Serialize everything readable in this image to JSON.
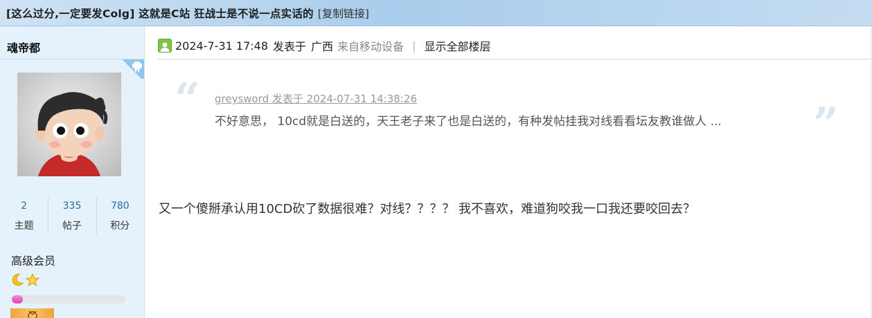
{
  "header": {
    "thread_title": "[这么过分,一定要发Colg] 这就是C站 狂战士是不说一点实话的",
    "copy_link_label": "[复制链接]"
  },
  "user": {
    "name": "魂帝都",
    "stats": [
      {
        "value": "2",
        "label": "主题"
      },
      {
        "value": "335",
        "label": "帖子"
      },
      {
        "value": "780",
        "label": "积分"
      }
    ],
    "rank": "高级会员",
    "rank_icons": [
      "moon-icon",
      "star-icon"
    ],
    "level_progress": 0.1
  },
  "post": {
    "timestamp": "2024-7-31 17:48",
    "posted_at": "发表于",
    "location": "广西",
    "device": "来自移动设备",
    "pipe": "|",
    "show_all_floors": "显示全部楼层",
    "quote": {
      "author_line": "greysword 发表于 2024-07-31 14:38:26",
      "text": "不好意思， 10cd就是白送的，天王老子来了也是白送的，有种发帖挂我对线看看坛友教谁做人 ..."
    },
    "body": "又一个傻掰承认用10CD砍了数据很难？对线？？？？ 我不喜欢，难道狗咬我一口我还要咬回去？"
  },
  "colors": {
    "header_bg": "#a9cdec",
    "sidebar_bg": "#e6f2fb",
    "stat_number": "#2a6a9c",
    "quote_mark": "#dbe6f1",
    "progress_fill": "#e040b8"
  }
}
